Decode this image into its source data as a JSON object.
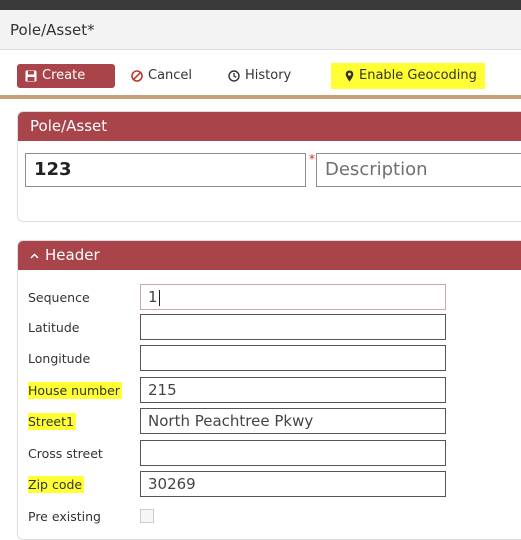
{
  "window": {
    "title": "Pole/Asset*"
  },
  "toolbar": {
    "create_label": "Create",
    "cancel_label": "Cancel",
    "history_label": "History",
    "geocoding_label": "Enable Geocoding",
    "accent_color": "#a9444a",
    "highlight_color": "#ffff33"
  },
  "asset_panel": {
    "title": "Pole/Asset",
    "code_value": "123",
    "description_placeholder": "Description",
    "required_marker": "*"
  },
  "header_panel": {
    "title": "Header",
    "collapse_icon": "chevron-up-icon",
    "fields": [
      {
        "label": "Sequence",
        "value": "1"
      },
      {
        "label": "Latitude",
        "value": ""
      },
      {
        "label": "Longitude",
        "value": ""
      },
      {
        "label": "House number",
        "value": "215"
      },
      {
        "label": "Street1",
        "value": "North Peachtree Pkwy"
      },
      {
        "label": "Cross street",
        "value": ""
      },
      {
        "label": "Zip code",
        "value": "30269"
      },
      {
        "label": "Pre existing",
        "value": ""
      }
    ]
  }
}
